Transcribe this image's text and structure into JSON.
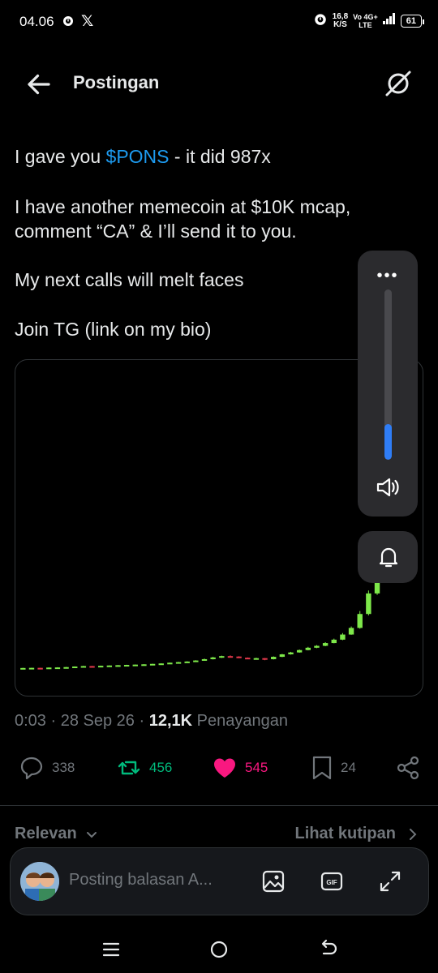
{
  "status_bar": {
    "time": "04.06",
    "x_logo": "𝕏",
    "speed_value": "16,8",
    "speed_unit": "K/S",
    "net_top": "Vo 4G+",
    "net_bottom": "LTE",
    "battery": "61",
    "icons": [
      "alarm-icon",
      "x-logo-icon",
      "alarm-icon",
      "signal-icon",
      "battery-icon"
    ]
  },
  "header": {
    "title": "Postingan",
    "back_icon": "arrow-left-icon",
    "right_icon": "grok-icon"
  },
  "post": {
    "line1_pre": "I gave you ",
    "line1_ticker": "$PONS",
    "line1_post": " - it did 987x",
    "line2": "I have another memecoin at $10K mcap,",
    "line3": "comment “CA” & I’ll send it to you.",
    "line4": "My next calls will melt faces",
    "line5": "Join TG (link on my bio)"
  },
  "volume_overlay": {
    "menu": "•••",
    "level": 0.21,
    "accent": "#2f7df6"
  },
  "meta": {
    "time": "0:03",
    "sep1": " · ",
    "date": "28 Sep 26",
    "sep2": " · ",
    "views": "12,1K",
    "views_label": " Penayangan"
  },
  "actions": {
    "replies": "338",
    "retweets": "456",
    "likes": "545",
    "bookmarks": "24"
  },
  "tabs": {
    "left": "Relevan",
    "right": "Lihat kutipan"
  },
  "reply": {
    "placeholder": "Posting balasan A..."
  },
  "colors": {
    "accent_blue": "#1d9bf0",
    "retweet_green": "#00ba7c",
    "like_pink": "#f91880",
    "candle_up": "#7ee84a",
    "candle_down": "#e0384b"
  },
  "chart_data": {
    "type": "candlestick",
    "title": "",
    "xlabel": "",
    "ylabel": "",
    "candles": [
      {
        "o": 1.0,
        "c": 1.2,
        "h": 1.3,
        "l": 0.9
      },
      {
        "o": 1.2,
        "c": 1.3,
        "h": 1.4,
        "l": 1.1
      },
      {
        "o": 1.3,
        "c": 1.2,
        "h": 1.4,
        "l": 1.1
      },
      {
        "o": 1.2,
        "c": 1.5,
        "h": 1.6,
        "l": 1.1
      },
      {
        "o": 1.5,
        "c": 1.6,
        "h": 1.7,
        "l": 1.4
      },
      {
        "o": 1.6,
        "c": 1.8,
        "h": 1.9,
        "l": 1.5
      },
      {
        "o": 1.8,
        "c": 2.2,
        "h": 2.3,
        "l": 1.7
      },
      {
        "o": 2.2,
        "c": 2.5,
        "h": 2.7,
        "l": 2.1
      },
      {
        "o": 2.5,
        "c": 2.4,
        "h": 2.6,
        "l": 2.2
      },
      {
        "o": 2.4,
        "c": 2.7,
        "h": 2.8,
        "l": 2.3
      },
      {
        "o": 2.7,
        "c": 2.9,
        "h": 3.0,
        "l": 2.6
      },
      {
        "o": 2.9,
        "c": 3.1,
        "h": 3.2,
        "l": 2.8
      },
      {
        "o": 3.1,
        "c": 3.3,
        "h": 3.4,
        "l": 3.0
      },
      {
        "o": 3.3,
        "c": 3.5,
        "h": 3.6,
        "l": 3.2
      },
      {
        "o": 3.5,
        "c": 3.7,
        "h": 3.8,
        "l": 3.4
      },
      {
        "o": 3.7,
        "c": 4.0,
        "h": 4.1,
        "l": 3.6
      },
      {
        "o": 4.0,
        "c": 4.3,
        "h": 4.4,
        "l": 3.9
      },
      {
        "o": 4.3,
        "c": 4.8,
        "h": 4.9,
        "l": 4.2
      },
      {
        "o": 4.8,
        "c": 5.2,
        "h": 5.4,
        "l": 4.7
      },
      {
        "o": 5.2,
        "c": 5.6,
        "h": 5.8,
        "l": 5.0
      },
      {
        "o": 5.6,
        "c": 6.3,
        "h": 6.5,
        "l": 5.5
      },
      {
        "o": 6.3,
        "c": 7.2,
        "h": 7.6,
        "l": 6.2
      },
      {
        "o": 7.2,
        "c": 8.4,
        "h": 8.8,
        "l": 7.0
      },
      {
        "o": 8.4,
        "c": 9.3,
        "h": 9.6,
        "l": 8.0
      },
      {
        "o": 9.3,
        "c": 9.0,
        "h": 9.8,
        "l": 8.6
      },
      {
        "o": 9.0,
        "c": 8.2,
        "h": 9.2,
        "l": 7.9
      },
      {
        "o": 8.2,
        "c": 7.6,
        "h": 8.4,
        "l": 7.3
      },
      {
        "o": 7.6,
        "c": 7.9,
        "h": 8.2,
        "l": 7.2
      },
      {
        "o": 7.9,
        "c": 7.2,
        "h": 8.0,
        "l": 6.5
      },
      {
        "o": 7.2,
        "c": 8.8,
        "h": 9.1,
        "l": 7.0
      },
      {
        "o": 8.8,
        "c": 10.5,
        "h": 10.8,
        "l": 8.6
      },
      {
        "o": 10.5,
        "c": 11.8,
        "h": 12.2,
        "l": 10.3
      },
      {
        "o": 11.8,
        "c": 13.4,
        "h": 13.8,
        "l": 11.6
      },
      {
        "o": 13.4,
        "c": 15.0,
        "h": 15.6,
        "l": 13.2
      },
      {
        "o": 15.0,
        "c": 16.3,
        "h": 16.8,
        "l": 14.7
      },
      {
        "o": 16.3,
        "c": 18.2,
        "h": 18.8,
        "l": 16.0
      },
      {
        "o": 18.2,
        "c": 20.5,
        "h": 21.2,
        "l": 18.0
      },
      {
        "o": 20.5,
        "c": 24.0,
        "h": 25.0,
        "l": 20.2
      },
      {
        "o": 24.0,
        "c": 28.5,
        "h": 29.5,
        "l": 23.8
      },
      {
        "o": 28.5,
        "c": 38.0,
        "h": 40.0,
        "l": 28.0
      },
      {
        "o": 38.0,
        "c": 52.0,
        "h": 54.0,
        "l": 37.0
      },
      {
        "o": 52.0,
        "c": 64.0,
        "h": 66.0,
        "l": 51.0
      },
      {
        "o": 64.0,
        "c": 80.0,
        "h": 82.0,
        "l": 62.0
      }
    ],
    "ylim": [
      0,
      200
    ],
    "grid": false
  }
}
